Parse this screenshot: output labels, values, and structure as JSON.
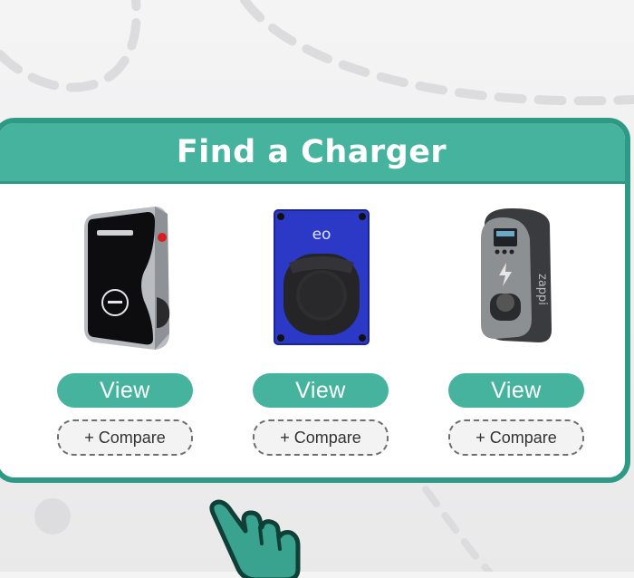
{
  "title": "Find a Charger",
  "colors": {
    "accent": "#45b39d",
    "accent_dark": "#2e9a86",
    "blue_charger": "#2b39c6"
  },
  "products": [
    {
      "id": "projectev",
      "view_label": "View",
      "compare_label": "+ Compare"
    },
    {
      "id": "eo",
      "view_label": "View",
      "compare_label": "+ Compare",
      "brand_text": "eo"
    },
    {
      "id": "zappi",
      "view_label": "View",
      "compare_label": "+ Compare"
    }
  ]
}
